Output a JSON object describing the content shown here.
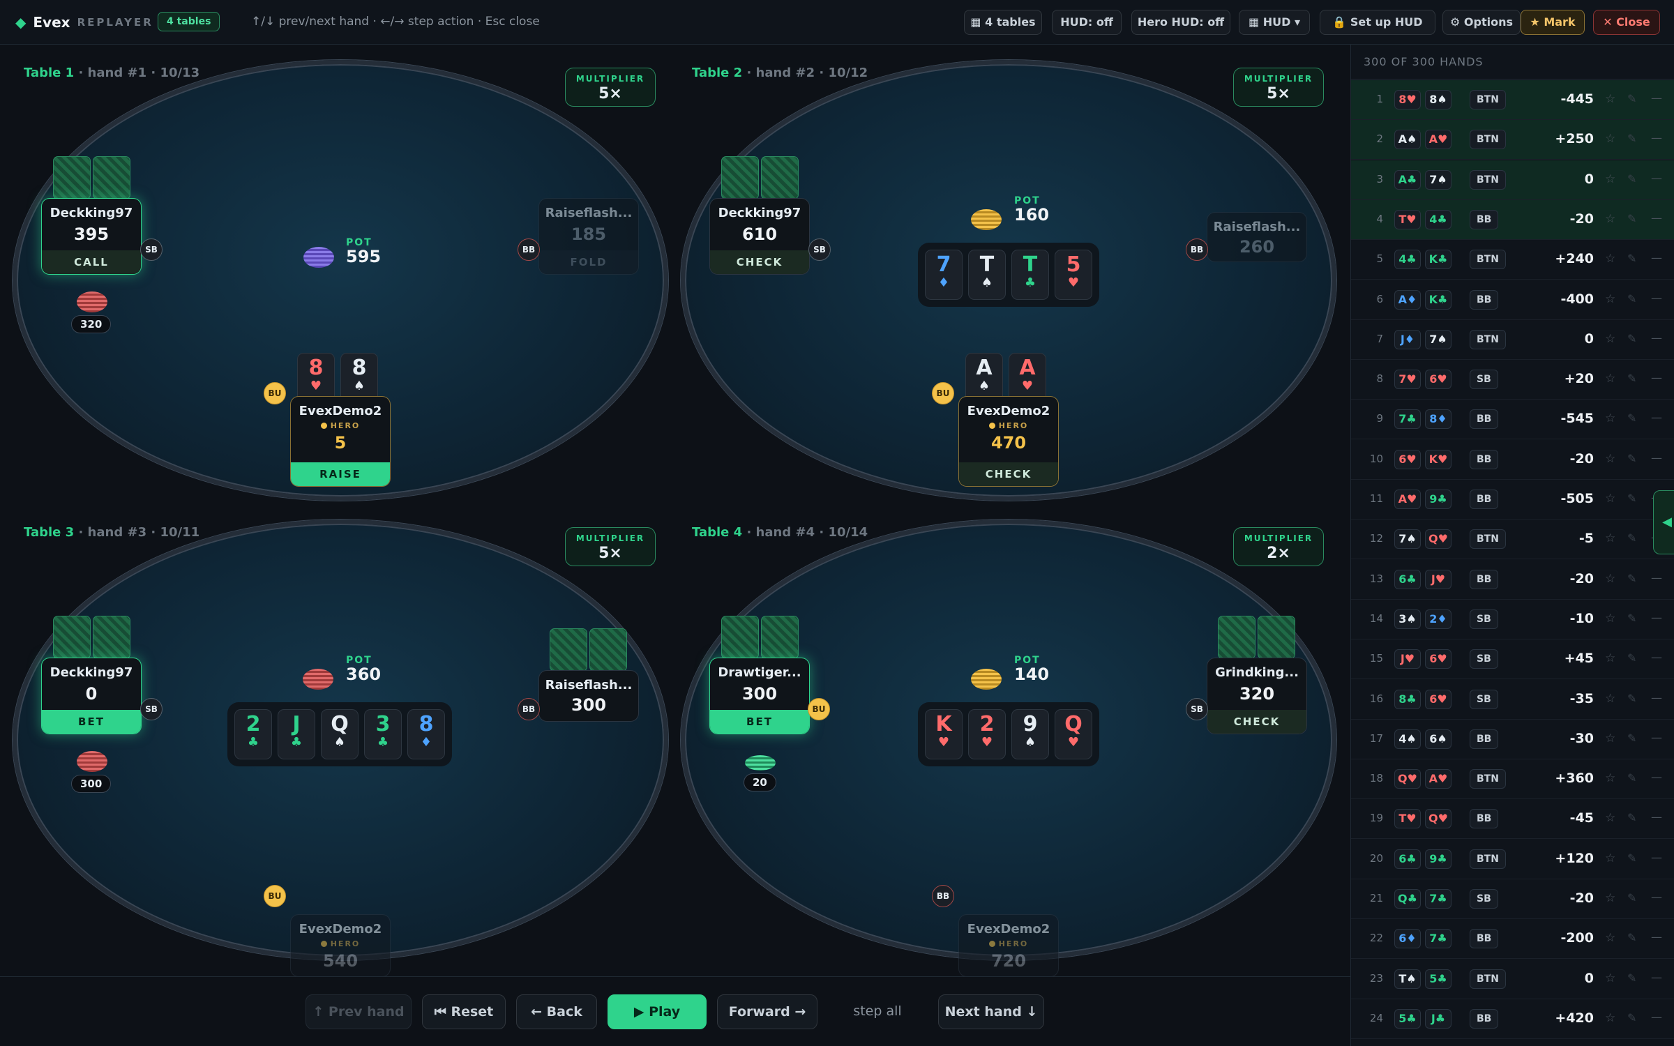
{
  "header": {
    "brand": "Evex",
    "brand_sub": "REPLAYER",
    "tables_badge": "4 tables",
    "hint": "↑/↓ prev/next hand · ←/→ step action · Esc close",
    "buttons": {
      "tables": "▦ 4 tables",
      "hud": "HUD: off",
      "hero_hud": "Hero HUD: off",
      "hud_menu": "▦ HUD ▾",
      "setup_hud": "🔒 Set up HUD",
      "options": "⚙ Options",
      "mark": "★ Mark",
      "close": "✕ Close"
    }
  },
  "tables": [
    {
      "name": "Table 1",
      "meta": "· hand #1 · 10/13",
      "mult_label": "MULTIPLIER",
      "mult": "5×",
      "opp1": {
        "name": "Deckking97",
        "stack": "395",
        "action": "CALL",
        "pos": "SB",
        "bet": "320"
      },
      "opp2": {
        "name": "Raiseflash...",
        "stack": "185",
        "action": "FOLD",
        "pos": "BB"
      },
      "pot_label": "POT",
      "pot": "595",
      "hero": {
        "name": "EvexDemo2",
        "tag": "HERO",
        "stack": "5",
        "action": "RAISE",
        "pos": "BU",
        "cards": [
          {
            "r": "8",
            "s": "♥"
          },
          {
            "r": "8",
            "s": "♠"
          }
        ]
      }
    },
    {
      "name": "Table 2",
      "meta": "· hand #2 · 10/12",
      "mult_label": "MULTIPLIER",
      "mult": "5×",
      "opp1": {
        "name": "Deckking97",
        "stack": "610",
        "action": "CHECK",
        "pos": "SB"
      },
      "opp2": {
        "name": "Raiseflash...",
        "stack": "260",
        "pos": "BB"
      },
      "pot_label": "POT",
      "pot": "160",
      "board": [
        {
          "r": "7",
          "s": "♦"
        },
        {
          "r": "T",
          "s": "♠"
        },
        {
          "r": "T",
          "s": "♣"
        },
        {
          "r": "5",
          "s": "♥"
        }
      ],
      "hero": {
        "name": "EvexDemo2",
        "tag": "HERO",
        "stack": "470",
        "action": "CHECK",
        "pos": "BU",
        "cards": [
          {
            "r": "A",
            "s": "♠"
          },
          {
            "r": "A",
            "s": "♥"
          }
        ]
      }
    },
    {
      "name": "Table 3",
      "meta": "· hand #3 · 10/11",
      "mult_label": "MULTIPLIER",
      "mult": "5×",
      "opp1": {
        "name": "Deckking97",
        "stack": "0",
        "action": "BET",
        "pos": "SB",
        "bet": "300"
      },
      "opp2": {
        "name": "Raiseflash...",
        "stack": "300",
        "pos": "BB"
      },
      "pot_label": "POT",
      "pot": "360",
      "board": [
        {
          "r": "2",
          "s": "♣"
        },
        {
          "r": "J",
          "s": "♣"
        },
        {
          "r": "Q",
          "s": "♠"
        },
        {
          "r": "3",
          "s": "♣"
        },
        {
          "r": "8",
          "s": "♦"
        }
      ],
      "hero": {
        "name": "EvexDemo2",
        "tag": "HERO",
        "stack": "540",
        "pos": "BU"
      }
    },
    {
      "name": "Table 4",
      "meta": "· hand #4 · 10/14",
      "mult_label": "MULTIPLIER",
      "mult": "2×",
      "opp1": {
        "name": "Drawtiger...",
        "stack": "300",
        "action": "BET",
        "pos": "BU",
        "bet": "20"
      },
      "opp2": {
        "name": "Grindking...",
        "stack": "320",
        "action": "CHECK",
        "pos": "SB"
      },
      "pot_label": "POT",
      "pot": "140",
      "board": [
        {
          "r": "K",
          "s": "♥"
        },
        {
          "r": "2",
          "s": "♥"
        },
        {
          "r": "9",
          "s": "♠"
        },
        {
          "r": "Q",
          "s": "♥"
        }
      ],
      "hero": {
        "name": "EvexDemo2",
        "tag": "HERO",
        "stack": "720",
        "pos": "BB"
      }
    }
  ],
  "controls": {
    "prev": "↑ Prev hand",
    "reset": "⏮ Reset",
    "back": "← Back",
    "play": "▶ Play",
    "forward": "Forward →",
    "step_all": "step all",
    "next": "Next hand ↓"
  },
  "handlist": {
    "header": "300 OF 300 HANDS",
    "rows": [
      [
        "1",
        "8♥",
        "8♠",
        "BTN",
        "-445"
      ],
      [
        "2",
        "A♠",
        "A♥",
        "BTN",
        "+250"
      ],
      [
        "3",
        "A♣",
        "7♠",
        "BTN",
        "0"
      ],
      [
        "4",
        "T♥",
        "4♣",
        "BB",
        "-20"
      ],
      [
        "5",
        "4♣",
        "K♣",
        "BTN",
        "+240"
      ],
      [
        "6",
        "A♦",
        "K♣",
        "BB",
        "-400"
      ],
      [
        "7",
        "J♦",
        "7♠",
        "BTN",
        "0"
      ],
      [
        "8",
        "7♥",
        "6♥",
        "SB",
        "+20"
      ],
      [
        "9",
        "7♣",
        "8♦",
        "BB",
        "-545"
      ],
      [
        "10",
        "6♥",
        "K♥",
        "BB",
        "-20"
      ],
      [
        "11",
        "A♥",
        "9♣",
        "BB",
        "-505"
      ],
      [
        "12",
        "7♠",
        "Q♥",
        "BTN",
        "-5"
      ],
      [
        "13",
        "6♣",
        "J♥",
        "BB",
        "-20"
      ],
      [
        "14",
        "3♠",
        "2♦",
        "SB",
        "-10"
      ],
      [
        "15",
        "J♥",
        "6♥",
        "SB",
        "+45"
      ],
      [
        "16",
        "8♣",
        "6♥",
        "SB",
        "-35"
      ],
      [
        "17",
        "4♠",
        "6♠",
        "BB",
        "-30"
      ],
      [
        "18",
        "Q♥",
        "A♥",
        "BTN",
        "+360"
      ],
      [
        "19",
        "T♥",
        "Q♥",
        "BB",
        "-45"
      ],
      [
        "20",
        "6♣",
        "9♣",
        "BTN",
        "+120"
      ],
      [
        "21",
        "Q♣",
        "7♣",
        "SB",
        "-20"
      ],
      [
        "22",
        "6♦",
        "7♣",
        "BB",
        "-200"
      ],
      [
        "23",
        "T♠",
        "5♣",
        "BTN",
        "0"
      ],
      [
        "24",
        "5♣",
        "J♣",
        "BB",
        "+420"
      ]
    ],
    "star": "☆",
    "pencil": "✎",
    "dash": "—",
    "collapse": "◀"
  }
}
